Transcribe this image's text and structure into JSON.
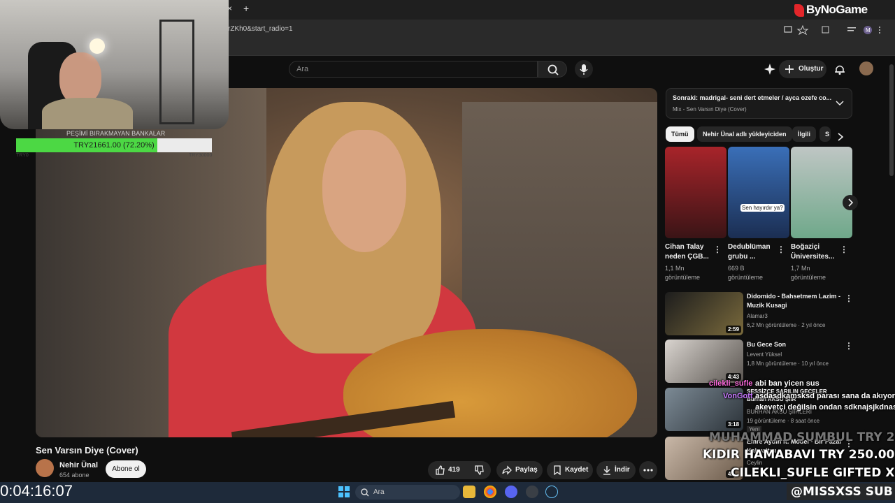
{
  "browser": {
    "url_fragment": "rZKh0&start_radio=1",
    "close_tab": "×",
    "new_tab": "+",
    "profile_initial": "M"
  },
  "youtube": {
    "search_placeholder": "Ara",
    "create_label": "Oluştur"
  },
  "video": {
    "title": "Sen Varsın Diye (Cover)",
    "channel": "Nehir Ünal",
    "subscribers": "654 abone",
    "subscribe_label": "Abone ol",
    "likes": "419",
    "share_label": "Paylaş",
    "save_label": "Kaydet",
    "download_label": "İndir"
  },
  "sidebar": {
    "playlist_title": "Sonraki: madrigal- seni dert etmeler / ayca ozefe co...",
    "playlist_sub": "Mix - Sen Varsın Diye (Cover)",
    "chips": [
      "Tümü",
      "Nehir Ünal adlı yükleyiciden",
      "İlgili",
      "S"
    ],
    "shorts": [
      {
        "title": "Cihan Talay\nneden ÇGB...",
        "meta": "1,1 Mn\ngörüntüleme"
      },
      {
        "title": "Dedublüman\ngrubu ...",
        "meta": "669 B\ngörüntüleme",
        "thumb_caption": "Sen hayırdır ya?"
      },
      {
        "title": "Boğaziçi\nÜniversites...",
        "meta": "1,7 Mn\ngörüntüleme"
      }
    ],
    "videos": [
      {
        "title": "Didomido - Bahsetmem Lazim -\nMuzik Kusagi",
        "channel": "Alamar3",
        "meta": "6,2 Mn görüntüleme · 2 yıl önce",
        "duration": "2:59"
      },
      {
        "title": "Bu Gece Son",
        "channel": "Levent Yüksel",
        "meta": "1,8 Mn görüntüleme · 10 yıl önce",
        "duration": "4:43"
      },
      {
        "title": "SESSİZCE SARILIN GECELER\nBurhan AKSU ŞİİR",
        "channel": "BURHAN AKSU ŞİİRLERİ",
        "meta": "19 görüntüleme · 8 saat önce",
        "duration": "3:18",
        "badge": "Yeni"
      },
      {
        "title": "Emre Aydın ft. Model - Bir Pazar\nKahvaltısı",
        "channel": "Ceylin",
        "meta": "",
        "duration": "4:"
      }
    ]
  },
  "overlay": {
    "goal_label": "PEŞİMİ BIRAKMAYAN BANKALAR",
    "goal_text": "TRY21661.00 (72.20%)",
    "goal_fraction": 0.722,
    "goal_min": "TRY0",
    "goal_max": "TRY30000",
    "brand": "ByNoGame",
    "chat": [
      {
        "user": "cilekli_sufle",
        "msg": "abi ban yicen sus"
      },
      {
        "user": "VonGott",
        "msg": "asdasdkamsksd parası sana da akıyor"
      },
      {
        "user": "",
        "msg": "akevetçi değilsin ondan sdknajsjkdnasd"
      }
    ],
    "donation1": "MUHAMMAD SUMBUL  TRY 250.00",
    "donation2": "KIDIR HAMABAVI  TRY 250.00",
    "gift": "CILEKLI_SUFLE  GIFTED X1",
    "timer": "0:04:16:07",
    "handle": "@MISSXSS  SUB"
  },
  "taskbar": {
    "search_placeholder": "Ara"
  },
  "colors": {
    "goal_fill": "#4cd844",
    "subscribe_bg": "#f1f1f1",
    "chat_user": "#ff6adf",
    "brand_red": "#e3262a"
  }
}
